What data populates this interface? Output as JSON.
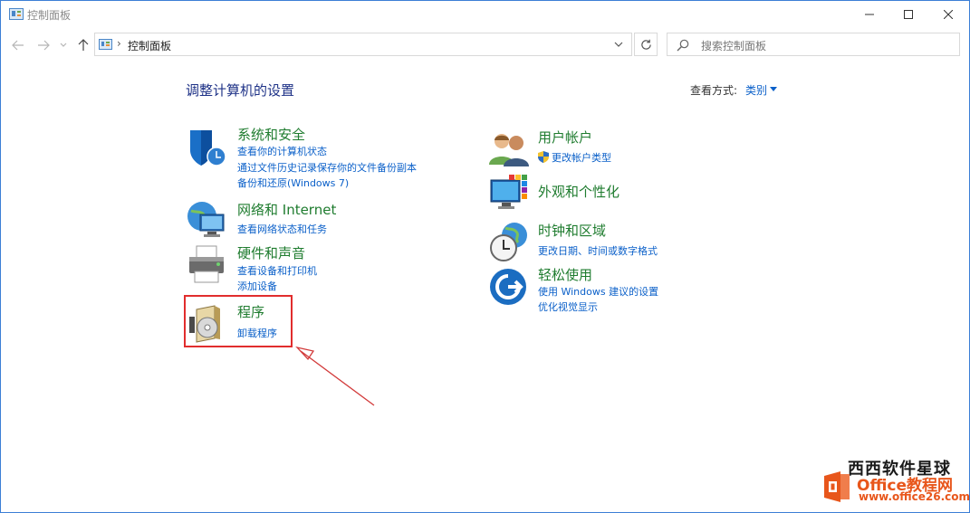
{
  "window": {
    "title": "控制面板"
  },
  "address": {
    "path": "控制面板"
  },
  "search": {
    "placeholder": "搜索控制面板"
  },
  "content": {
    "heading": "调整计算机的设置",
    "view_by_label": "查看方式:",
    "view_by_value": "类别"
  },
  "categories": {
    "system": {
      "title": "系统和安全",
      "links": [
        "查看你的计算机状态",
        "通过文件历史记录保存你的文件备份副本",
        "备份和还原(Windows 7)"
      ]
    },
    "network": {
      "title": "网络和 Internet",
      "links": [
        "查看网络状态和任务"
      ]
    },
    "hardware": {
      "title": "硬件和声音",
      "links": [
        "查看设备和打印机",
        "添加设备"
      ]
    },
    "programs": {
      "title": "程序",
      "links": [
        "卸载程序"
      ]
    },
    "users": {
      "title": "用户帐户",
      "links": [
        "更改帐户类型"
      ]
    },
    "appearance": {
      "title": "外观和个性化",
      "links": []
    },
    "clock": {
      "title": "时钟和区域",
      "links": [
        "更改日期、时间或数字格式"
      ]
    },
    "ease": {
      "title": "轻松使用",
      "links": [
        "使用 Windows 建议的设置",
        "优化视觉显示"
      ]
    }
  },
  "watermark": {
    "line1": "西西软件星球",
    "line2": "Office教程网",
    "line3": "www.office26.com"
  },
  "colors": {
    "link": "#0b60c9",
    "category_title": "#1f7c2f",
    "heading": "#1e3287",
    "highlight": "#e12d2d"
  }
}
